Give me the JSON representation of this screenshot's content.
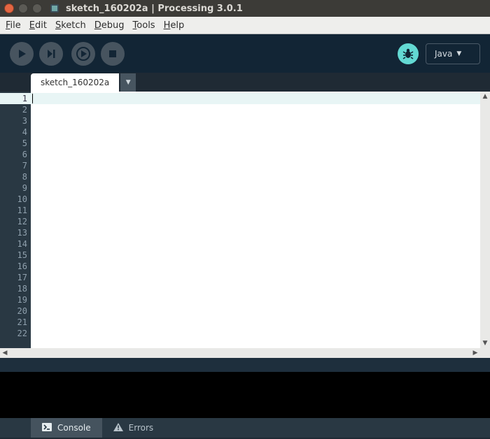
{
  "window": {
    "title": "sketch_160202a | Processing 3.0.1"
  },
  "menu": {
    "file": {
      "label": "File",
      "accel": "F"
    },
    "edit": {
      "label": "Edit",
      "accel": "E"
    },
    "sketch": {
      "label": "Sketch",
      "accel": "S"
    },
    "debug": {
      "label": "Debug",
      "accel": "D"
    },
    "tools": {
      "label": "Tools",
      "accel": "T"
    },
    "help": {
      "label": "Help",
      "accel": "H"
    }
  },
  "toolbar": {
    "mode_label": "Java"
  },
  "tabs": {
    "active": "sketch_160202a"
  },
  "editor": {
    "line_count": 22,
    "active_line": 1
  },
  "bottom": {
    "console_label": "Console",
    "errors_label": "Errors"
  }
}
